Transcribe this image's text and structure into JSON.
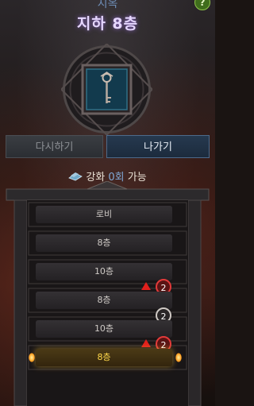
{
  "header": {
    "subtitle": "지옥",
    "title": "지하 8층",
    "help_label": "?"
  },
  "buttons": {
    "retry": "다시하기",
    "leave": "나가기"
  },
  "enhance": {
    "prefix": "강화 ",
    "count": "0회",
    "suffix": " 가능"
  },
  "floors": [
    {
      "label": "로비"
    },
    {
      "label": "8층"
    },
    {
      "label": "10층",
      "badge": "2",
      "badge_color": "red",
      "warning": true
    },
    {
      "label": "8층",
      "badge": "2",
      "badge_color": "white"
    },
    {
      "label": "10층",
      "badge": "2",
      "badge_color": "red",
      "warning": true
    },
    {
      "label": "8층",
      "current": true
    }
  ],
  "colors": {
    "title": "#e6d7ff",
    "current_floor": "#ffd84a",
    "badge_red": "#e23a3a",
    "leave_button": "#1c2b3d"
  }
}
